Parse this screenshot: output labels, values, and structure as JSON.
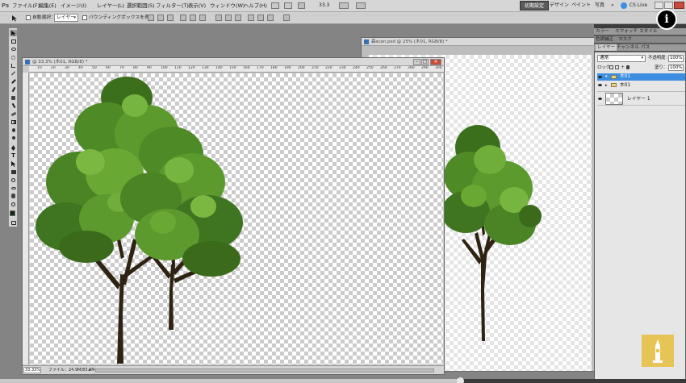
{
  "menubar": {
    "app_logo": "Ps",
    "items": [
      "ファイル(F)",
      "編集(E)",
      "イメージ(I)",
      "レイヤー(L)",
      "選択範囲(S)",
      "フィルター(T)",
      "表示(V)",
      "ウィンドウ(W)",
      "ヘルプ(H)"
    ],
    "zoom": "33.3",
    "workspaces": [
      "初期設定",
      "デザイン",
      "ペイント",
      "写真"
    ],
    "more": "»",
    "cs_live": "CS Live"
  },
  "options_bar": {
    "auto_select_label": "自動選択：",
    "auto_select_target": "レイヤー",
    "bounding_box_label": "バウンディングボックスを表示"
  },
  "doc_front": {
    "title": "@ 33.3% (木01, RGB/8) *",
    "ruler_numbers": [
      "10",
      "20",
      "30",
      "40",
      "50",
      "60",
      "70",
      "80",
      "90",
      "100",
      "110",
      "120",
      "130",
      "140",
      "150",
      "160",
      "170",
      "180",
      "190",
      "200",
      "210",
      "220",
      "230",
      "240",
      "250",
      "260",
      "270",
      "280",
      "290",
      "300"
    ],
    "status_zoom": "33.33%",
    "status_file": "ファイル：24.9M/83.0M"
  },
  "doc_back": {
    "title": "森scan.psd @ 25% (木01, RGB/8) *"
  },
  "panel": {
    "top_tabs": [
      "カラー",
      "スウォッチ",
      "スタイル"
    ],
    "mid_tabs": [
      "色調補正",
      "マスク"
    ],
    "layer_tabs": [
      "レイヤー",
      "チャンネル",
      "パス"
    ],
    "blend_mode": "通常",
    "opacity_label": "不透明度：",
    "opacity_value": "100%",
    "lock_label": "ロック：",
    "fill_label": "塗り：",
    "fill_value": "100%",
    "layers": [
      {
        "name": "木01",
        "selected": true,
        "type": "group"
      },
      {
        "name": "木01",
        "selected": false,
        "type": "group"
      },
      {
        "name": "レイヤー 1",
        "selected": false,
        "type": "pixel"
      }
    ]
  },
  "overlay": {
    "info_icon_label": "i"
  },
  "colors": {
    "accent": "#3d8ee0",
    "foliage": "#4e8a26",
    "trunk": "#2e2212",
    "logo_bg": "#e8c24a"
  }
}
